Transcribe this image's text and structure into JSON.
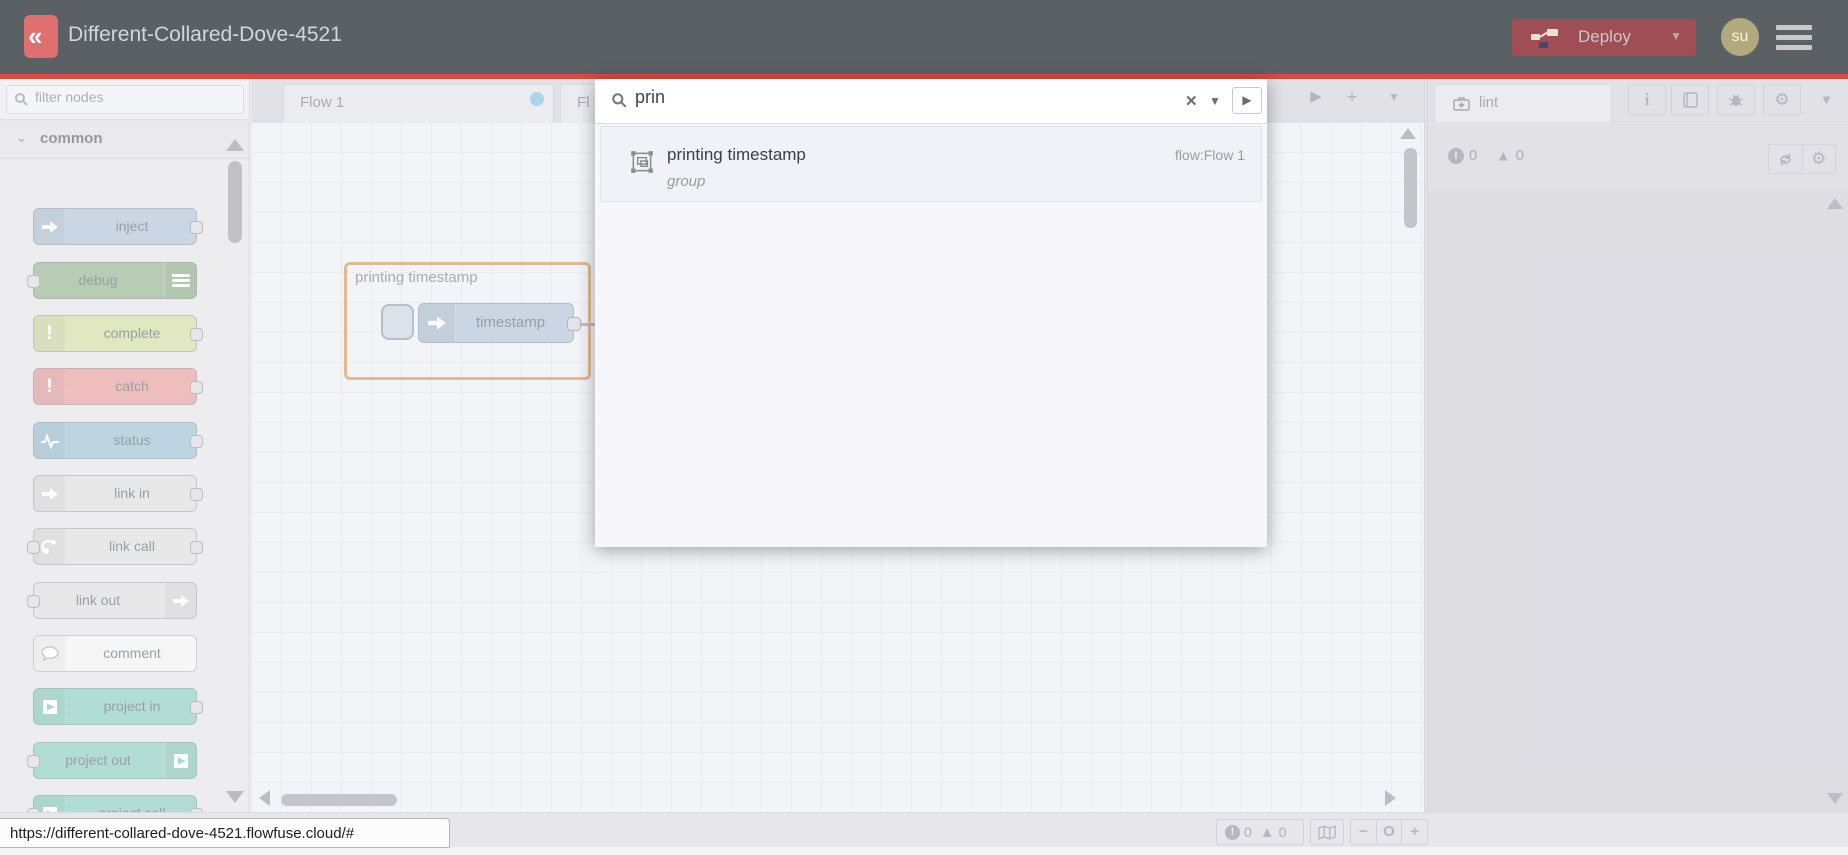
{
  "header": {
    "title": "Different-Collared-Dove-4521",
    "deploy_label": "Deploy",
    "avatar_initials": "su"
  },
  "palette": {
    "filter_placeholder": "filter nodes",
    "category": "common",
    "nodes": [
      {
        "label": "inject",
        "color": "#a6bbcf",
        "icon": "arrow-in",
        "ports": "right"
      },
      {
        "label": "debug",
        "color": "#87a980",
        "icon": "debug-sidebar",
        "ports": "left"
      },
      {
        "label": "complete",
        "color": "#cbd795",
        "icon": "exclamation",
        "ports": "right"
      },
      {
        "label": "catch",
        "color": "#e49191",
        "icon": "exclamation",
        "ports": "right"
      },
      {
        "label": "status",
        "color": "#8fb9cc",
        "icon": "pulse",
        "ports": "right"
      },
      {
        "label": "link in",
        "color": "#d9d9d9",
        "icon": "link-arrow",
        "ports": "right"
      },
      {
        "label": "link call",
        "color": "#d9d9d9",
        "icon": "link-call",
        "ports": "both"
      },
      {
        "label": "link out",
        "color": "#d9d9d9",
        "icon": "link-arrow",
        "ports": "left"
      },
      {
        "label": "comment",
        "color": "#f2f2f2",
        "icon": "speech-bubble",
        "ports": "none"
      },
      {
        "label": "project in",
        "color": "#7cc7b5",
        "icon": "project-logo",
        "ports": "right"
      },
      {
        "label": "project out",
        "color": "#7cc7b5",
        "icon": "project-logo",
        "ports": "left"
      },
      {
        "label": "project call",
        "color": "#7cc7b5",
        "icon": "project-logo",
        "ports": "both"
      }
    ]
  },
  "workspace": {
    "tabs": [
      {
        "label": "Flow 1",
        "dirty": true
      },
      {
        "label": "Fl"
      }
    ],
    "group": {
      "label": "printing timestamp",
      "node_label": "timestamp"
    }
  },
  "search": {
    "query": "prin",
    "results": [
      {
        "title": "printing timestamp",
        "meta": "flow:Flow 1",
        "subtitle": "group"
      }
    ]
  },
  "sidebar": {
    "tab_label": "lint",
    "errors": "0",
    "warnings": "0"
  },
  "canvas_footer": {
    "errors": "0",
    "warnings": "0",
    "zoom_out": "−",
    "zoom_reset": "O",
    "zoom_in": "+"
  },
  "statusbar": {
    "url": "https://different-collared-dove-4521.flowfuse.cloud/#"
  },
  "colors": {
    "header_bg": "#5b6065",
    "accent_red_line": "#d94a45",
    "deploy_btn": "#9e4e54",
    "logo": "#e07070",
    "avatar_bg": "#b2aa7c",
    "group_border": "#d08a3e",
    "dirty_dot": "#74b9da"
  }
}
